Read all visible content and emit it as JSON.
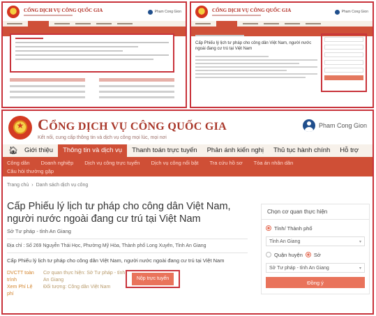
{
  "header": {
    "title_first": "C",
    "title_rest": "ỔNG DỊCH VỤ CÔNG QUỐC GIA",
    "subtitle": "Kết nối, cung cấp thông tin và dịch vụ công mọi lúc, mọi nơi",
    "user_name": "Pham Cong Gion"
  },
  "nav": {
    "items": [
      "Giới thiệu",
      "Thông tin và dịch vụ",
      "Thanh toán trực tuyến",
      "Phản ánh kiến nghị",
      "Thủ tục hành chính",
      "Hỗ trợ"
    ]
  },
  "subnav": {
    "row1": [
      "Công dân",
      "Doanh nghiệp",
      "Dịch vụ công trực tuyến",
      "Dịch vụ công nổi bật",
      "Tra cứu hồ sơ",
      "Tòa án nhân dân"
    ],
    "row2": [
      "Câu hỏi thường gặp"
    ]
  },
  "breadcrumb": {
    "home": "Trang chủ",
    "current": "Danh sách dịch vụ công"
  },
  "service": {
    "title": "Cấp Phiếu lý lịch tư pháp cho công dân Việt Nam, người nước ngoài đang cư trú tại Việt Nam",
    "agency": "Sở Tư pháp - tỉnh An Giang",
    "address": "Địa chỉ : Số 269 Nguyễn Thái Học, Phường Mỹ Hòa, Thành phố Long Xuyên, Tỉnh An Giang",
    "description": "Cấp Phiếu lý lịch tư pháp cho công dân Việt Nam, người nước ngoài đang cư trú tại Việt Nam",
    "code_line1": "DVCTT toàn trình",
    "code_line2": "Xem Phí Lệ phí",
    "info_line1": "Cơ quan thực hiện: Sở Tư pháp - tỉnh An Giang",
    "info_line2": "Đối tượng: Công dân Việt Nam",
    "submit_label": "Nộp trực tuyến"
  },
  "panel": {
    "heading": "Chọn cơ quan thực hiện",
    "radio_province": "Tỉnh/ Thành phố",
    "province_value": "Tỉnh An Giang",
    "radio_district": "Quận huyện",
    "radio_department": "Sở",
    "department_value": "Sở Tư pháp - tỉnh An Giang",
    "confirm_label": "Đồng ý"
  },
  "thumb_right": {
    "title": "Cấp Phiếu lý lịch tư pháp cho công dân Việt Nam, người nước ngoài đang cư trú tại Việt Nam"
  },
  "colors": {
    "brand_red": "#cf4f36",
    "highlight": "#c8323a",
    "button": "#e9735b"
  }
}
